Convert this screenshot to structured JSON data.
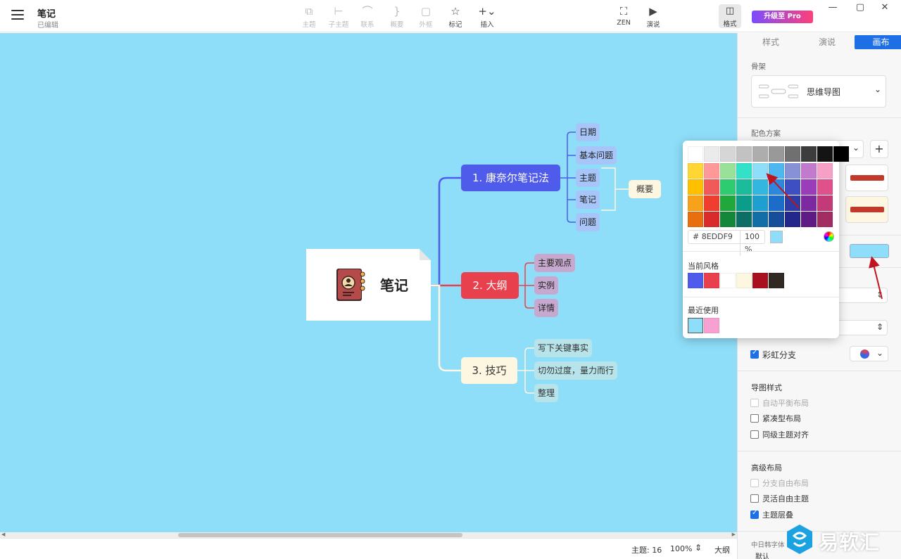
{
  "header": {
    "title": "笔记",
    "subtitle": "已编辑",
    "tools": [
      {
        "label": "主题",
        "icon": "topic-icon",
        "disabled": true
      },
      {
        "label": "子主题",
        "icon": "subtopic-icon",
        "disabled": true
      },
      {
        "label": "联系",
        "icon": "relationship-icon",
        "disabled": true
      },
      {
        "label": "概要",
        "icon": "summary-icon",
        "disabled": true
      },
      {
        "label": "外框",
        "icon": "boundary-icon",
        "disabled": true
      },
      {
        "label": "标记",
        "icon": "star-icon",
        "disabled": false
      },
      {
        "label": "插入",
        "icon": "plus-icon",
        "disabled": false
      },
      {
        "label": "ZEN",
        "icon": "fullscreen-icon",
        "disabled": false
      },
      {
        "label": "演说",
        "icon": "play-icon",
        "disabled": false
      }
    ],
    "format_label": "格式",
    "pro_label": "升级至 Pro"
  },
  "canvas": {
    "background": "#8EDDF9",
    "root": {
      "label": "笔记"
    },
    "branches": [
      {
        "label": "1. 康奈尔笔记法",
        "color": "#4F5BEA",
        "children": [
          "日期",
          "基本问题",
          "主题",
          "笔记",
          "问题"
        ]
      },
      {
        "label": "2. 大纲",
        "color": "#E9404D",
        "children": [
          "主要观点",
          "实例",
          "详情"
        ]
      },
      {
        "label": "3. 技巧",
        "color": "#FDF6E0",
        "children": [
          "写下关键事实",
          "切勿过度，量力而行",
          "整理"
        ]
      }
    ],
    "summary_label": "概要"
  },
  "status": {
    "topics": "主题: 16",
    "zoom": "100%",
    "font": "大纲"
  },
  "panel": {
    "tabs": [
      "样式",
      "演说",
      "画布"
    ],
    "active_tab": "画布",
    "skeleton_label": "骨架",
    "skeleton_value": "思维导图",
    "scheme_label": "配色方案",
    "rainbow_label": "彩虹分支",
    "rainbow_checked": true,
    "map_style_label": "导图样式",
    "map_style_options": [
      {
        "label": "自动平衡布局",
        "checked": false,
        "disabled": true
      },
      {
        "label": "紧凑型布局",
        "checked": false,
        "disabled": false
      },
      {
        "label": "同级主题对齐",
        "checked": false,
        "disabled": false
      }
    ],
    "advanced_label": "高级布局",
    "advanced_options": [
      {
        "label": "分支自由布局",
        "checked": false,
        "disabled": true
      },
      {
        "label": "灵活自由主题",
        "checked": false,
        "disabled": false
      },
      {
        "label": "主题层叠",
        "checked": true,
        "disabled": false
      }
    ],
    "cjk_font_label": "中日韩字体",
    "cjk_font_value": "默认",
    "bg_color": "#8EDDF9"
  },
  "color_picker": {
    "palette_rows": [
      [
        "#FFFFFF",
        "#EBEBEB",
        "#D6D6D6",
        "#C2C2C2",
        "#ADADAD",
        "#999999",
        "#707070",
        "#3D3D3D",
        "#141414",
        "#000000"
      ],
      [
        "#FFD633",
        "#FF9999",
        "#99E099",
        "#33E0C8",
        "#8EDDF9",
        "#4FB7F0",
        "#8791D6",
        "#C27ACD",
        "#F7A0C7"
      ],
      [
        "#FFC000",
        "#F25A5A",
        "#2ECC71",
        "#1ABC9C",
        "#33B7E0",
        "#2E86DE",
        "#3E4FC4",
        "#9B3DB8",
        "#E0508A"
      ],
      [
        "#F7A21A",
        "#F03E2E",
        "#21A83D",
        "#0C9C8A",
        "#1F9ED0",
        "#1C6DC9",
        "#2E3CA6",
        "#7D2AA0",
        "#C23A77"
      ],
      [
        "#E86E0E",
        "#D92B2B",
        "#14873B",
        "#0C6E64",
        "#136EA8",
        "#164E99",
        "#23268A",
        "#5E1C84",
        "#A32C63"
      ]
    ],
    "hex_value": "# 8EDDF9",
    "opacity": "100 %",
    "current_style_label": "当前风格",
    "current_style_colors": [
      "#4F5BEA",
      "#E9404D",
      "#FFFFFF",
      "#FDF6E0",
      "#A8101E",
      "#302A22"
    ],
    "recent_label": "最近使用",
    "recent_colors": [
      "#8EDDF9",
      "#F7A0D2"
    ]
  },
  "watermark": {
    "text": "易软汇"
  }
}
